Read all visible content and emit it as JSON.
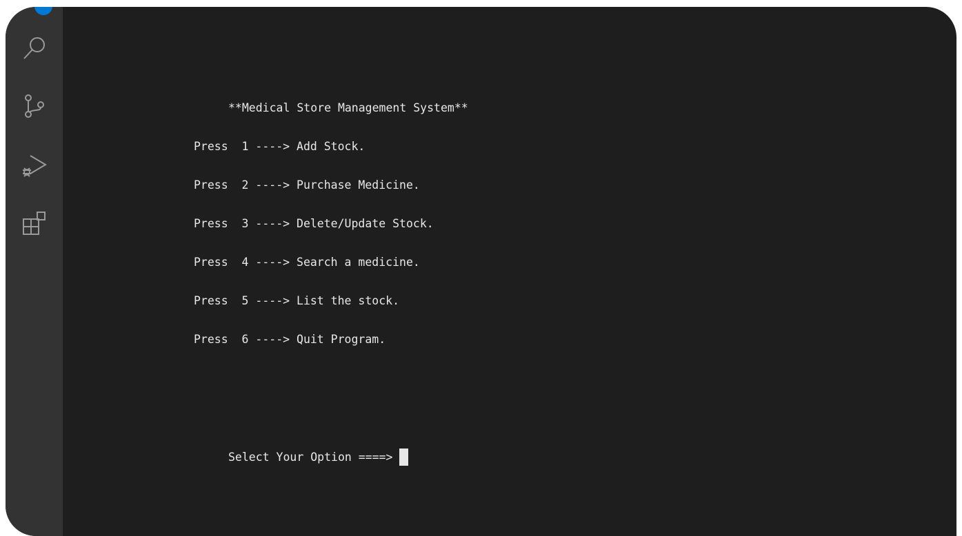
{
  "activity_bar": {
    "icons": [
      "search-icon",
      "source-control-icon",
      "run-debug-icon",
      "extensions-icon"
    ]
  },
  "terminal": {
    "title": "**Medical Store Management System**",
    "menu": [
      "Press  1 ----> Add Stock.",
      "Press  2 ----> Purchase Medicine.",
      "Press  3 ----> Delete/Update Stock.",
      "Press  4 ----> Search a medicine.",
      "Press  5 ----> List the stock.",
      "Press  6 ----> Quit Program."
    ],
    "prompt": "Select Your Option ====>"
  },
  "colors": {
    "background": "#1e1e1e",
    "activity_bar": "#333333",
    "text": "#e8e8e8",
    "accent": "#0078d4"
  }
}
